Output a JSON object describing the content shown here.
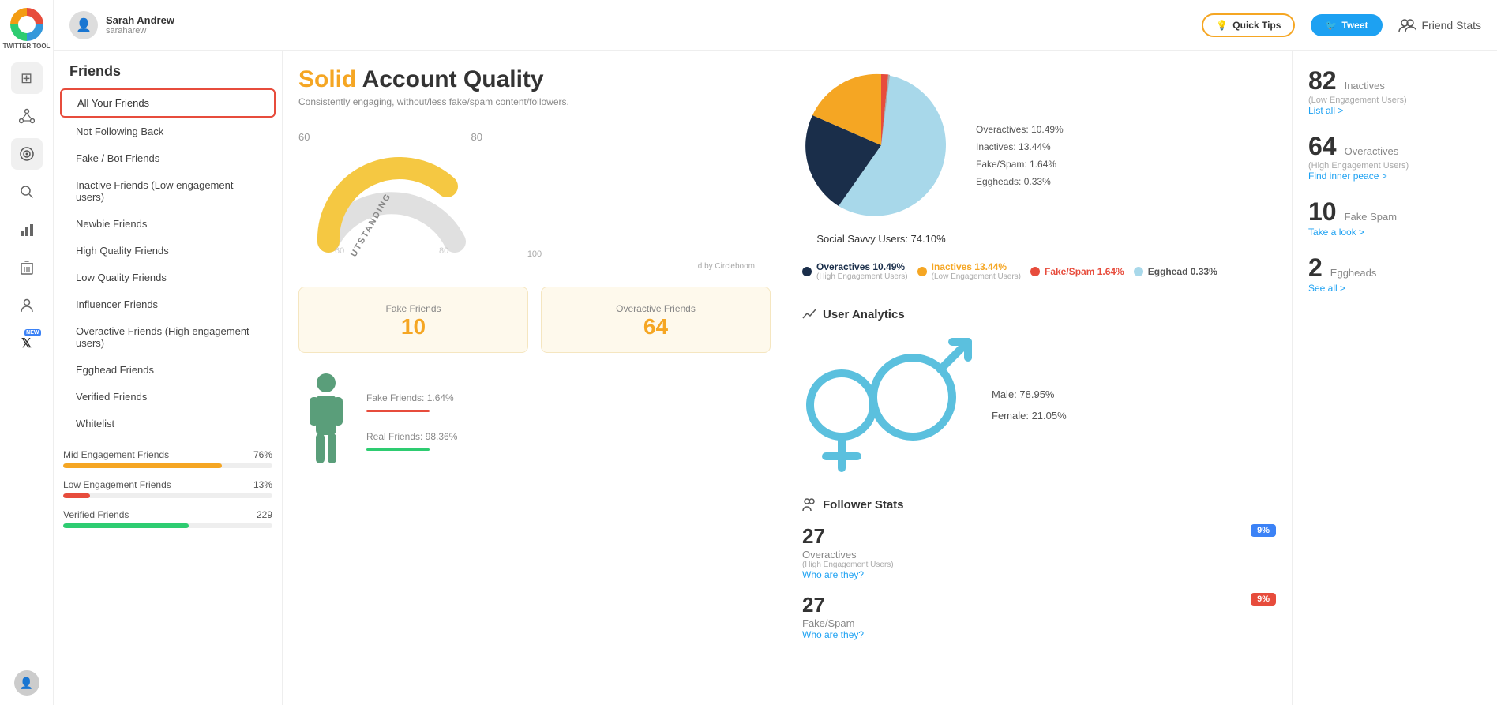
{
  "app": {
    "name": "TWITTER TOOL"
  },
  "topbar": {
    "user": {
      "name": "Sarah Andrew",
      "handle": "saraharew",
      "avatar": "👤"
    },
    "quick_tips_label": "Quick Tips",
    "tweet_label": "Tweet",
    "friend_stats_label": "Friend Stats"
  },
  "sidebar_icons": [
    {
      "name": "grid-icon",
      "symbol": "⊞"
    },
    {
      "name": "network-icon",
      "symbol": "✦"
    },
    {
      "name": "target-icon",
      "symbol": "◎"
    },
    {
      "name": "search-icon",
      "symbol": "🔍"
    },
    {
      "name": "chart-icon",
      "symbol": "📊"
    },
    {
      "name": "trash-icon",
      "symbol": "🗑"
    },
    {
      "name": "person-icon",
      "symbol": "👤"
    },
    {
      "name": "x-icon",
      "symbol": "𝕏"
    }
  ],
  "nav": {
    "title": "Friends",
    "items": [
      {
        "label": "All Your Friends",
        "active": true
      },
      {
        "label": "Not Following Back",
        "active": false
      },
      {
        "label": "Fake / Bot Friends",
        "active": false
      },
      {
        "label": "Inactive Friends (Low engagement users)",
        "active": false
      },
      {
        "label": "Newbie Friends",
        "active": false
      },
      {
        "label": "High Quality Friends",
        "active": false
      },
      {
        "label": "Low Quality Friends",
        "active": false
      },
      {
        "label": "Influencer Friends",
        "active": false
      },
      {
        "label": "Overactive Friends (High engagement users)",
        "active": false
      },
      {
        "label": "Egghead Friends",
        "active": false
      },
      {
        "label": "Verified Friends",
        "active": false
      },
      {
        "label": "Whitelist",
        "active": false
      }
    ],
    "engagement": [
      {
        "label": "Mid Engagement Friends",
        "value": "76%",
        "percent": 76,
        "color": "#f5a623"
      },
      {
        "label": "Low Engagement Friends",
        "value": "13%",
        "percent": 13,
        "color": "#e74c3c"
      },
      {
        "label": "Verified Friends",
        "value": "229",
        "percent": 60,
        "color": "#2ecc71"
      }
    ]
  },
  "quality": {
    "title_solid": "Solid",
    "title_rest": " Account Quality",
    "subtitle": "Consistently engaging, without/less fake/spam content/followers.",
    "gauge_value": 80,
    "gauge_label": "OUTSTANDING"
  },
  "stats_boxes": {
    "fake_friends_label": "Fake Friends",
    "fake_friends_value": "10",
    "overactive_friends_label": "Overactive Friends",
    "overactive_friends_value": "64"
  },
  "pie_chart": {
    "segments": [
      {
        "label": "Social Savvy Users",
        "percent": 74.1,
        "color": "#a8d8ea"
      },
      {
        "label": "Overactives",
        "percent": 10.49,
        "color": "#1a2e4a"
      },
      {
        "label": "Inactives",
        "percent": 13.44,
        "color": "#f5a623"
      },
      {
        "label": "Fake/Spam",
        "percent": 1.64,
        "color": "#e74c3c"
      },
      {
        "label": "Eggheads",
        "percent": 0.33,
        "color": "#888"
      }
    ],
    "legend": [
      {
        "text": "Overactives: 10.49%"
      },
      {
        "text": "Inactives: 13.44%"
      },
      {
        "text": "Fake/Spam: 1.64%"
      },
      {
        "text": "Eggheads: 0.33%"
      }
    ],
    "social_savvy_label": "Social Savvy Users: 74.10%",
    "badges": [
      {
        "label": "Overactives 10.49%",
        "sub": "(High Engagement Users)",
        "color": "#1a2e4a"
      },
      {
        "label": "Inactives 13.44%",
        "sub": "(Low Engagement Users)",
        "color": "#f5a623"
      },
      {
        "label": "Fake/Spam 1.64%",
        "color": "#e74c3c"
      },
      {
        "label": "Egghead 0.33%",
        "color": "#a8d8ea"
      }
    ]
  },
  "user_analytics": {
    "title": "User Analytics",
    "figure_labels": [
      {
        "text": "Fake Friends: 1.64%"
      },
      {
        "text": "Real Friends: 98.36%"
      }
    ],
    "gender": {
      "male_percent": "Male: 78.95%",
      "female_percent": "Female: 21.05%"
    }
  },
  "follower_stats": {
    "title": "Follower Stats"
  },
  "right_stats": {
    "inactives": {
      "number": "82",
      "label": "Inactives",
      "sub": "(Low Engagement Users)",
      "link": "List all >"
    },
    "overactives": {
      "number": "64",
      "label": "Overactives",
      "sub": "(High Engagement Users)",
      "link": "Find inner peace >"
    },
    "fake_spam": {
      "number": "10",
      "label": "Fake Spam",
      "link": "Take a look >"
    },
    "eggheads": {
      "number": "2",
      "label": "Eggheads",
      "link": "See all >"
    }
  },
  "follower_right": {
    "overactives": {
      "number": "27",
      "label": "Overactives",
      "sub": "(High Engagement Users)",
      "link": "Who are they?",
      "badge": "9%",
      "badge_color": "blue"
    },
    "fake_spam": {
      "number": "27",
      "label": "Fake/Spam",
      "link": "Who are they?",
      "badge": "9%",
      "badge_color": "red"
    }
  }
}
